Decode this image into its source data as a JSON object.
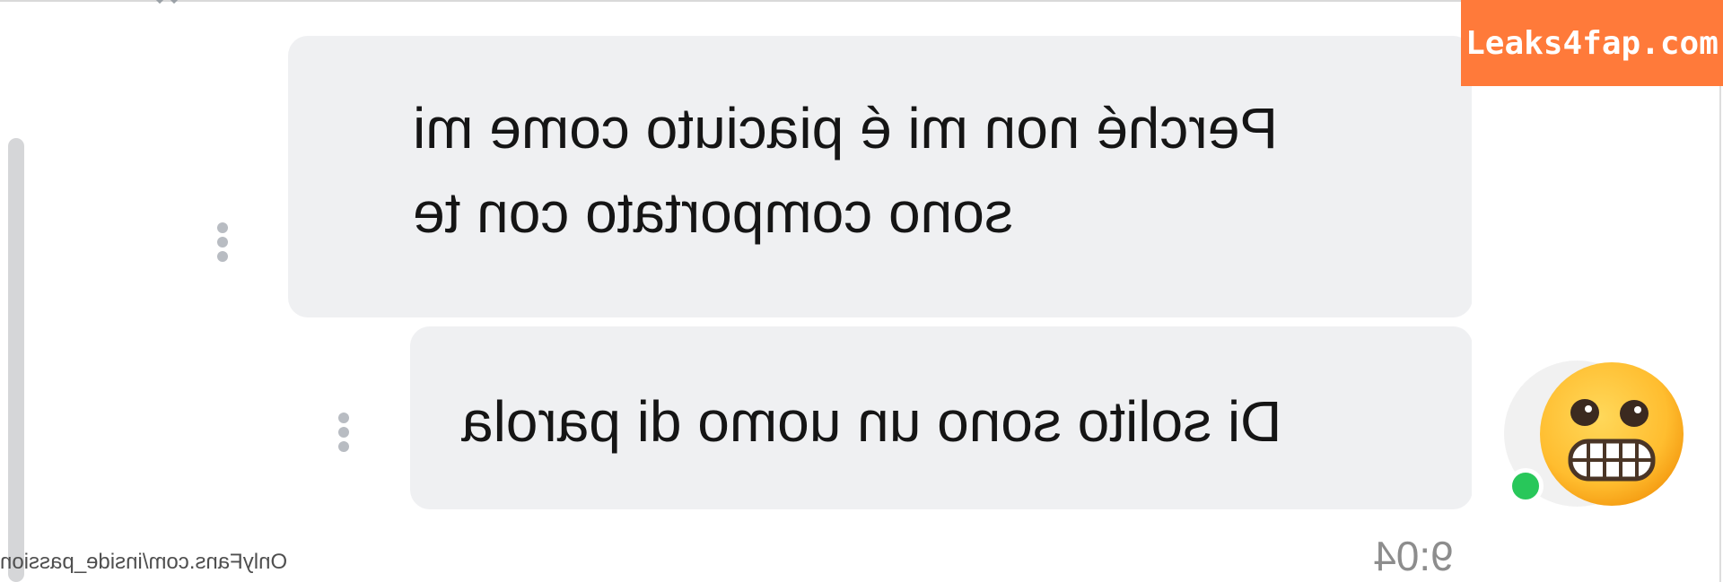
{
  "chat": {
    "messages": [
      {
        "text": "Perché non mi é piaciuto come mi\nsono comportato con te",
        "more_icon": "more-vertical-icon"
      },
      {
        "text": "Di solito sono un uomo di parola",
        "more_icon": "more-vertical-icon"
      }
    ],
    "timestamp": "9:04",
    "avatar": {
      "emoji_name": "grimacing-face-icon",
      "status": "online",
      "status_color": "#28c75a"
    }
  },
  "overlay": {
    "watermark_text": "OnlyFans.com/inside_passion",
    "brand_badge": "Leaks4fap.com",
    "brand_color": "#ff7a3a"
  },
  "colors": {
    "bubble_background": "#eff0f2",
    "message_text": "#151515",
    "timestamp": "#8d8d8d",
    "scrollbar": "#d5d6d8"
  }
}
